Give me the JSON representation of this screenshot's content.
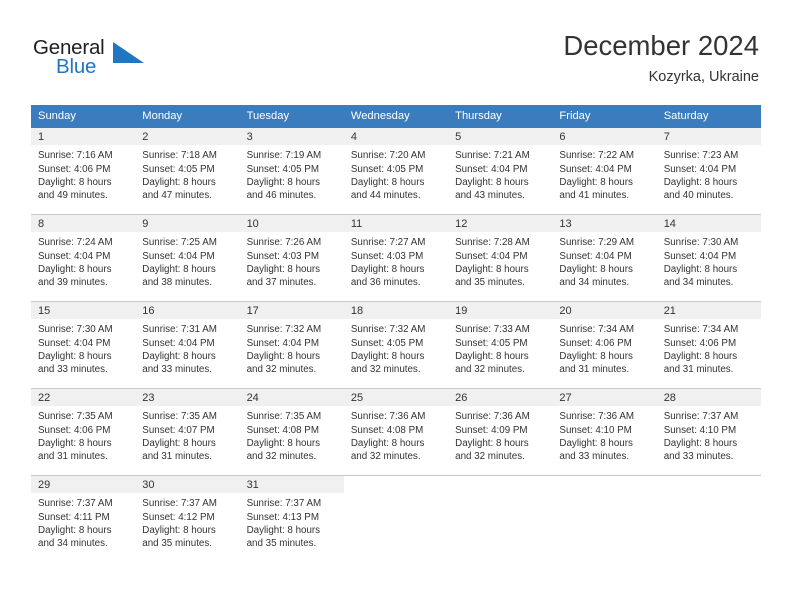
{
  "brand": {
    "name_part1": "General",
    "name_part2": "Blue",
    "logo_icon": "triangle-flag-icon",
    "accent_color": "#1f77c4"
  },
  "header": {
    "title": "December 2024",
    "location": "Kozyrka, Ukraine"
  },
  "calendar": {
    "header_bg": "#3a7cbe",
    "daynum_bg": "#f0f0f0",
    "weekday_headers": [
      "Sunday",
      "Monday",
      "Tuesday",
      "Wednesday",
      "Thursday",
      "Friday",
      "Saturday"
    ],
    "weeks": [
      [
        {
          "day": "1",
          "sunrise": "Sunrise: 7:16 AM",
          "sunset": "Sunset: 4:06 PM",
          "daylight_line1": "Daylight: 8 hours",
          "daylight_line2": "and 49 minutes."
        },
        {
          "day": "2",
          "sunrise": "Sunrise: 7:18 AM",
          "sunset": "Sunset: 4:05 PM",
          "daylight_line1": "Daylight: 8 hours",
          "daylight_line2": "and 47 minutes."
        },
        {
          "day": "3",
          "sunrise": "Sunrise: 7:19 AM",
          "sunset": "Sunset: 4:05 PM",
          "daylight_line1": "Daylight: 8 hours",
          "daylight_line2": "and 46 minutes."
        },
        {
          "day": "4",
          "sunrise": "Sunrise: 7:20 AM",
          "sunset": "Sunset: 4:05 PM",
          "daylight_line1": "Daylight: 8 hours",
          "daylight_line2": "and 44 minutes."
        },
        {
          "day": "5",
          "sunrise": "Sunrise: 7:21 AM",
          "sunset": "Sunset: 4:04 PM",
          "daylight_line1": "Daylight: 8 hours",
          "daylight_line2": "and 43 minutes."
        },
        {
          "day": "6",
          "sunrise": "Sunrise: 7:22 AM",
          "sunset": "Sunset: 4:04 PM",
          "daylight_line1": "Daylight: 8 hours",
          "daylight_line2": "and 41 minutes."
        },
        {
          "day": "7",
          "sunrise": "Sunrise: 7:23 AM",
          "sunset": "Sunset: 4:04 PM",
          "daylight_line1": "Daylight: 8 hours",
          "daylight_line2": "and 40 minutes."
        }
      ],
      [
        {
          "day": "8",
          "sunrise": "Sunrise: 7:24 AM",
          "sunset": "Sunset: 4:04 PM",
          "daylight_line1": "Daylight: 8 hours",
          "daylight_line2": "and 39 minutes."
        },
        {
          "day": "9",
          "sunrise": "Sunrise: 7:25 AM",
          "sunset": "Sunset: 4:04 PM",
          "daylight_line1": "Daylight: 8 hours",
          "daylight_line2": "and 38 minutes."
        },
        {
          "day": "10",
          "sunrise": "Sunrise: 7:26 AM",
          "sunset": "Sunset: 4:03 PM",
          "daylight_line1": "Daylight: 8 hours",
          "daylight_line2": "and 37 minutes."
        },
        {
          "day": "11",
          "sunrise": "Sunrise: 7:27 AM",
          "sunset": "Sunset: 4:03 PM",
          "daylight_line1": "Daylight: 8 hours",
          "daylight_line2": "and 36 minutes."
        },
        {
          "day": "12",
          "sunrise": "Sunrise: 7:28 AM",
          "sunset": "Sunset: 4:04 PM",
          "daylight_line1": "Daylight: 8 hours",
          "daylight_line2": "and 35 minutes."
        },
        {
          "day": "13",
          "sunrise": "Sunrise: 7:29 AM",
          "sunset": "Sunset: 4:04 PM",
          "daylight_line1": "Daylight: 8 hours",
          "daylight_line2": "and 34 minutes."
        },
        {
          "day": "14",
          "sunrise": "Sunrise: 7:30 AM",
          "sunset": "Sunset: 4:04 PM",
          "daylight_line1": "Daylight: 8 hours",
          "daylight_line2": "and 34 minutes."
        }
      ],
      [
        {
          "day": "15",
          "sunrise": "Sunrise: 7:30 AM",
          "sunset": "Sunset: 4:04 PM",
          "daylight_line1": "Daylight: 8 hours",
          "daylight_line2": "and 33 minutes."
        },
        {
          "day": "16",
          "sunrise": "Sunrise: 7:31 AM",
          "sunset": "Sunset: 4:04 PM",
          "daylight_line1": "Daylight: 8 hours",
          "daylight_line2": "and 33 minutes."
        },
        {
          "day": "17",
          "sunrise": "Sunrise: 7:32 AM",
          "sunset": "Sunset: 4:04 PM",
          "daylight_line1": "Daylight: 8 hours",
          "daylight_line2": "and 32 minutes."
        },
        {
          "day": "18",
          "sunrise": "Sunrise: 7:32 AM",
          "sunset": "Sunset: 4:05 PM",
          "daylight_line1": "Daylight: 8 hours",
          "daylight_line2": "and 32 minutes."
        },
        {
          "day": "19",
          "sunrise": "Sunrise: 7:33 AM",
          "sunset": "Sunset: 4:05 PM",
          "daylight_line1": "Daylight: 8 hours",
          "daylight_line2": "and 32 minutes."
        },
        {
          "day": "20",
          "sunrise": "Sunrise: 7:34 AM",
          "sunset": "Sunset: 4:06 PM",
          "daylight_line1": "Daylight: 8 hours",
          "daylight_line2": "and 31 minutes."
        },
        {
          "day": "21",
          "sunrise": "Sunrise: 7:34 AM",
          "sunset": "Sunset: 4:06 PM",
          "daylight_line1": "Daylight: 8 hours",
          "daylight_line2": "and 31 minutes."
        }
      ],
      [
        {
          "day": "22",
          "sunrise": "Sunrise: 7:35 AM",
          "sunset": "Sunset: 4:06 PM",
          "daylight_line1": "Daylight: 8 hours",
          "daylight_line2": "and 31 minutes."
        },
        {
          "day": "23",
          "sunrise": "Sunrise: 7:35 AM",
          "sunset": "Sunset: 4:07 PM",
          "daylight_line1": "Daylight: 8 hours",
          "daylight_line2": "and 31 minutes."
        },
        {
          "day": "24",
          "sunrise": "Sunrise: 7:35 AM",
          "sunset": "Sunset: 4:08 PM",
          "daylight_line1": "Daylight: 8 hours",
          "daylight_line2": "and 32 minutes."
        },
        {
          "day": "25",
          "sunrise": "Sunrise: 7:36 AM",
          "sunset": "Sunset: 4:08 PM",
          "daylight_line1": "Daylight: 8 hours",
          "daylight_line2": "and 32 minutes."
        },
        {
          "day": "26",
          "sunrise": "Sunrise: 7:36 AM",
          "sunset": "Sunset: 4:09 PM",
          "daylight_line1": "Daylight: 8 hours",
          "daylight_line2": "and 32 minutes."
        },
        {
          "day": "27",
          "sunrise": "Sunrise: 7:36 AM",
          "sunset": "Sunset: 4:10 PM",
          "daylight_line1": "Daylight: 8 hours",
          "daylight_line2": "and 33 minutes."
        },
        {
          "day": "28",
          "sunrise": "Sunrise: 7:37 AM",
          "sunset": "Sunset: 4:10 PM",
          "daylight_line1": "Daylight: 8 hours",
          "daylight_line2": "and 33 minutes."
        }
      ],
      [
        {
          "day": "29",
          "sunrise": "Sunrise: 7:37 AM",
          "sunset": "Sunset: 4:11 PM",
          "daylight_line1": "Daylight: 8 hours",
          "daylight_line2": "and 34 minutes."
        },
        {
          "day": "30",
          "sunrise": "Sunrise: 7:37 AM",
          "sunset": "Sunset: 4:12 PM",
          "daylight_line1": "Daylight: 8 hours",
          "daylight_line2": "and 35 minutes."
        },
        {
          "day": "31",
          "sunrise": "Sunrise: 7:37 AM",
          "sunset": "Sunset: 4:13 PM",
          "daylight_line1": "Daylight: 8 hours",
          "daylight_line2": "and 35 minutes."
        },
        {
          "day": "",
          "sunrise": "",
          "sunset": "",
          "daylight_line1": "",
          "daylight_line2": ""
        },
        {
          "day": "",
          "sunrise": "",
          "sunset": "",
          "daylight_line1": "",
          "daylight_line2": ""
        },
        {
          "day": "",
          "sunrise": "",
          "sunset": "",
          "daylight_line1": "",
          "daylight_line2": ""
        },
        {
          "day": "",
          "sunrise": "",
          "sunset": "",
          "daylight_line1": "",
          "daylight_line2": ""
        }
      ]
    ]
  }
}
